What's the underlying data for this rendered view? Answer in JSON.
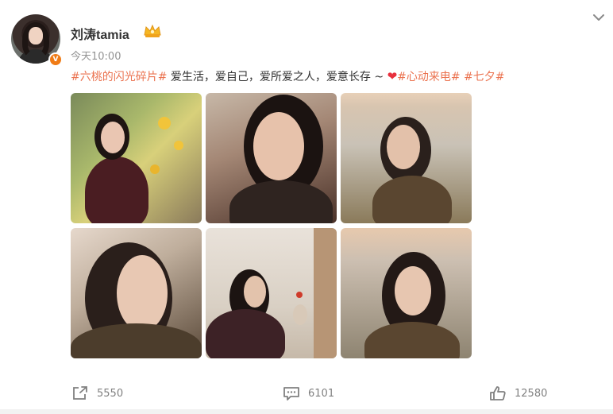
{
  "post": {
    "username": "刘涛tamia",
    "timestamp": "今天10:00",
    "text": {
      "tag1": "#六桃的闪光碎片#",
      "body": " 爱生活，爱自己，爱所爱之人，爱意长存 ~ ",
      "heart": "❤",
      "tag2": "#心动来电#",
      "tag3": "#七夕#"
    },
    "images": [
      {
        "name": "photo-1",
        "icon": "woman-with-flowers"
      },
      {
        "name": "photo-2",
        "icon": "woman-smiling-closeup"
      },
      {
        "name": "photo-3",
        "icon": "woman-reflection-window"
      },
      {
        "name": "photo-4",
        "icon": "woman-profile-closeup"
      },
      {
        "name": "photo-5",
        "icon": "woman-by-window"
      },
      {
        "name": "photo-6",
        "icon": "woman-through-glass"
      }
    ]
  },
  "actions": {
    "share_count": "5550",
    "comment_count": "6101",
    "like_count": "12580"
  },
  "colors": {
    "tag": "#eb7350",
    "heart": "#e8303d",
    "meta": "#939393",
    "verified": "#f07b16"
  }
}
